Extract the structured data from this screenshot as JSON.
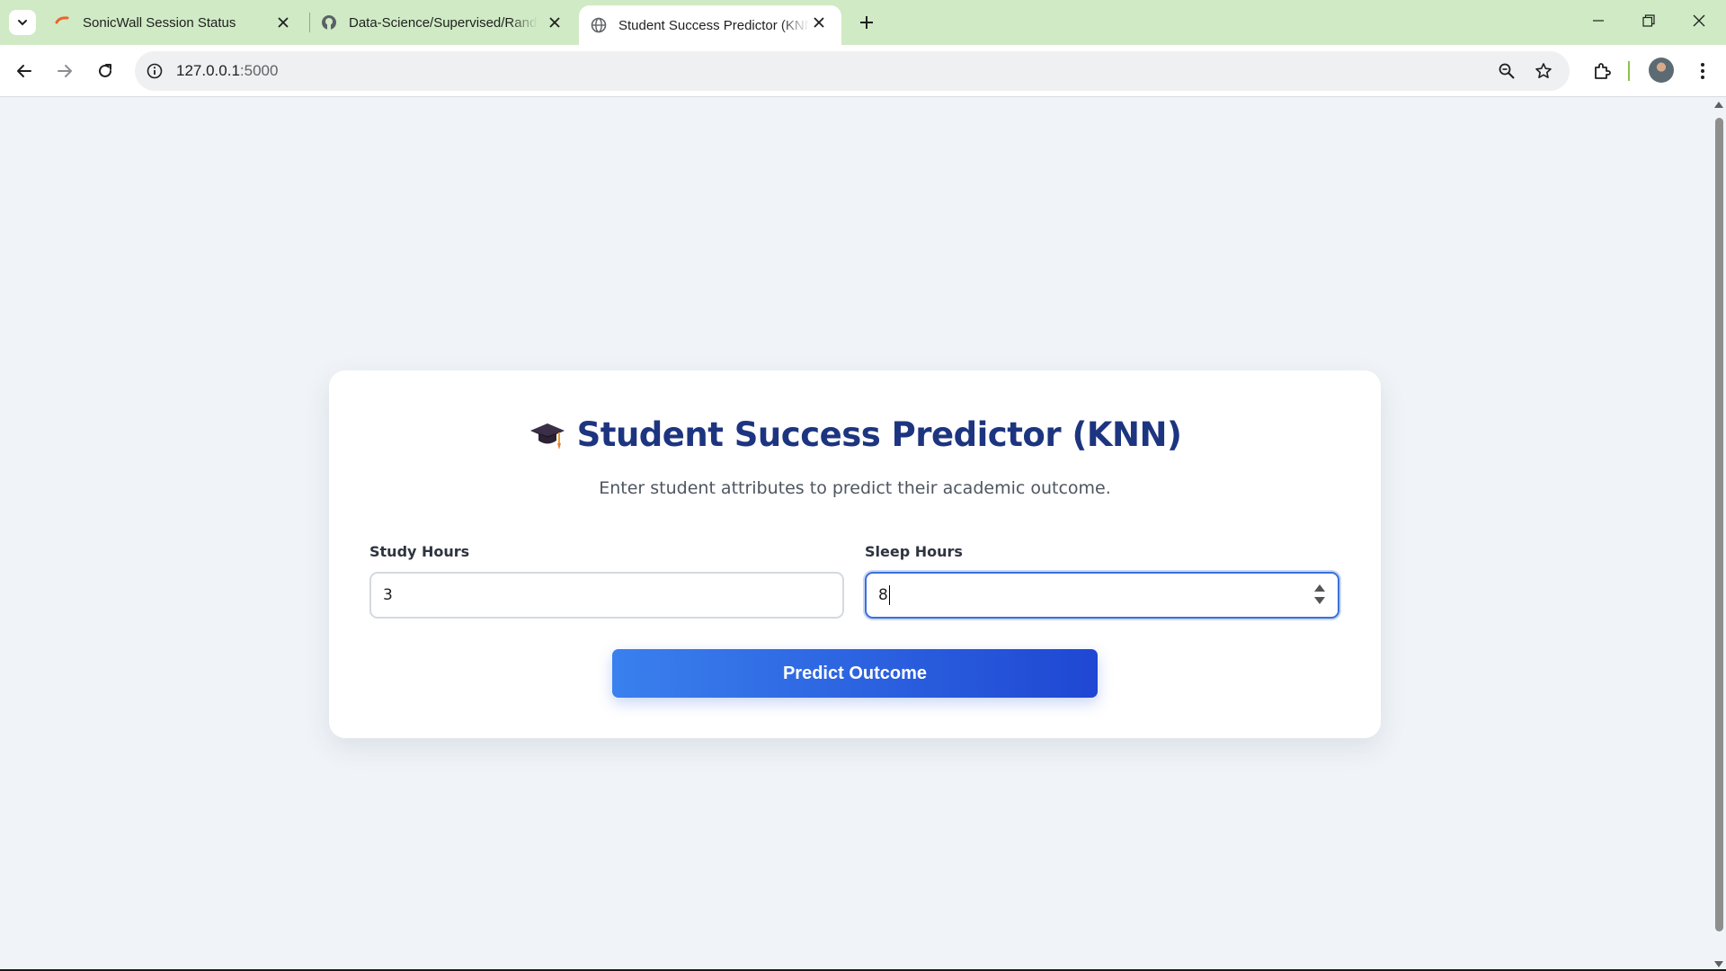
{
  "browser": {
    "tabs": [
      {
        "title": "SonicWall Session Status",
        "active": false,
        "favicon": "sonicwall-icon"
      },
      {
        "title": "Data-Science/Supervised/Random",
        "active": false,
        "favicon": "github-icon"
      },
      {
        "title": "Student Success Predictor (KNN)",
        "active": true,
        "favicon": "globe-icon"
      }
    ],
    "url_host": "127.0.0.1",
    "url_port": ":5000"
  },
  "page": {
    "title": "Student Success Predictor (KNN)",
    "subtitle": "Enter student attributes to predict their academic outcome.",
    "study_hours_label": "Study Hours",
    "study_hours_value": "3",
    "sleep_hours_label": "Sleep Hours",
    "sleep_hours_value": "8",
    "predict_button": "Predict Outcome"
  },
  "colors": {
    "tabstrip": "#cfeac4",
    "page_background": "#f0f4f8",
    "title": "#1d3580",
    "button_gradient_start": "#3a80ee",
    "button_gradient_end": "#1f47d3",
    "focus_border": "#3b6fd9"
  }
}
